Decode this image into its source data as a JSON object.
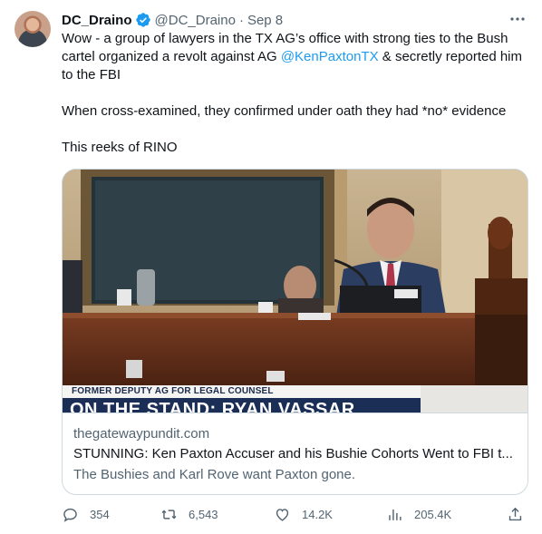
{
  "author": {
    "display_name": "DC_Draino",
    "handle": "@DC_Draino",
    "separator": "·",
    "date": "Sep 8"
  },
  "tweet": {
    "line1_before": "Wow - a group of lawyers in the TX AG’s office with strong ties to the Bush cartel organized a revolt against AG ",
    "mention": "@KenPaxtonTX",
    "line1_after": " & secretly reported him to the FBI",
    "line2": "When cross-examined, they confirmed under oath they had *no* evidence",
    "line3": "This reeks of RINO"
  },
  "card": {
    "lower_third_top": "FORMER DEPUTY AG FOR LEGAL COUNSEL",
    "lower_third_bottom": "ON THE STAND: RYAN VASSAR",
    "domain": "thegatewaypundit.com",
    "title": "STUNNING: Ken Paxton Accuser and his Bushie Cohorts Went to FBI t...",
    "description": "The Bushies and Karl Rove want Paxton gone."
  },
  "actions": {
    "replies": "354",
    "retweets": "6,543",
    "likes": "14.2K",
    "views": "205.4K"
  },
  "colors": {
    "text": "#0f1419",
    "secondary": "#536471",
    "link": "#1d9bf0",
    "border": "#cfd9de",
    "verified": "#1d9bf0"
  },
  "icons": [
    "verified-badge-icon",
    "more-icon",
    "reply-icon",
    "retweet-icon",
    "like-icon",
    "views-icon",
    "share-icon"
  ]
}
